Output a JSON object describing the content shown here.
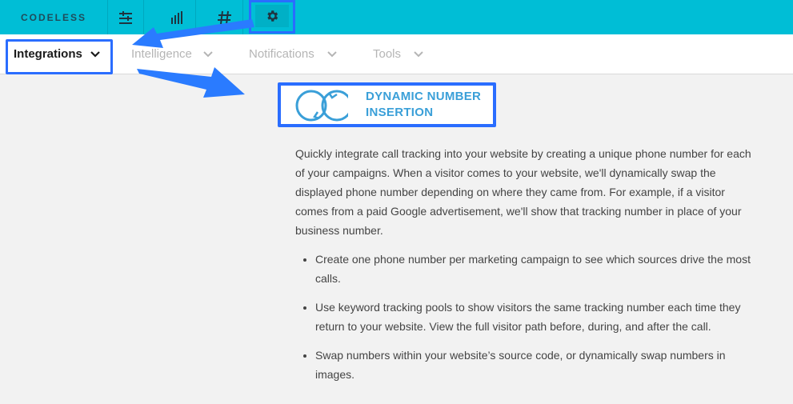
{
  "topbar": {
    "brand": "CODELESS",
    "icons": [
      "settings-sliders-icon",
      "bar-chart-icon",
      "hashtag-icon",
      "gear-icon"
    ],
    "accent": "#00bed6",
    "highlight": "#2a6dff"
  },
  "subnav": {
    "tabs": [
      {
        "label": "Integrations"
      },
      {
        "label": "Intelligence"
      },
      {
        "label": "Notifications"
      },
      {
        "label": "Tools"
      }
    ]
  },
  "logo": {
    "line1": "DYNAMIC NUMBER",
    "line2": "INSERTION",
    "color": "#3a9fd8"
  },
  "content": {
    "intro": "Quickly integrate call tracking into your website by creating a unique phone number for each of your campaigns. When a visitor comes to your website, we'll dynamically swap the displayed phone number depending on where they came from. For example, if a visitor comes from a paid Google advertisement, we'll show that tracking number in place of your business number.",
    "bullets": [
      "Create one phone number per marketing campaign to see which sources drive the most calls.",
      "Use keyword tracking pools to show visitors the same tracking number each time they return to your website. View the full visitor path before, during, and after the call.",
      "Swap numbers within your website’s source code, or dynamically swap numbers in images."
    ]
  }
}
